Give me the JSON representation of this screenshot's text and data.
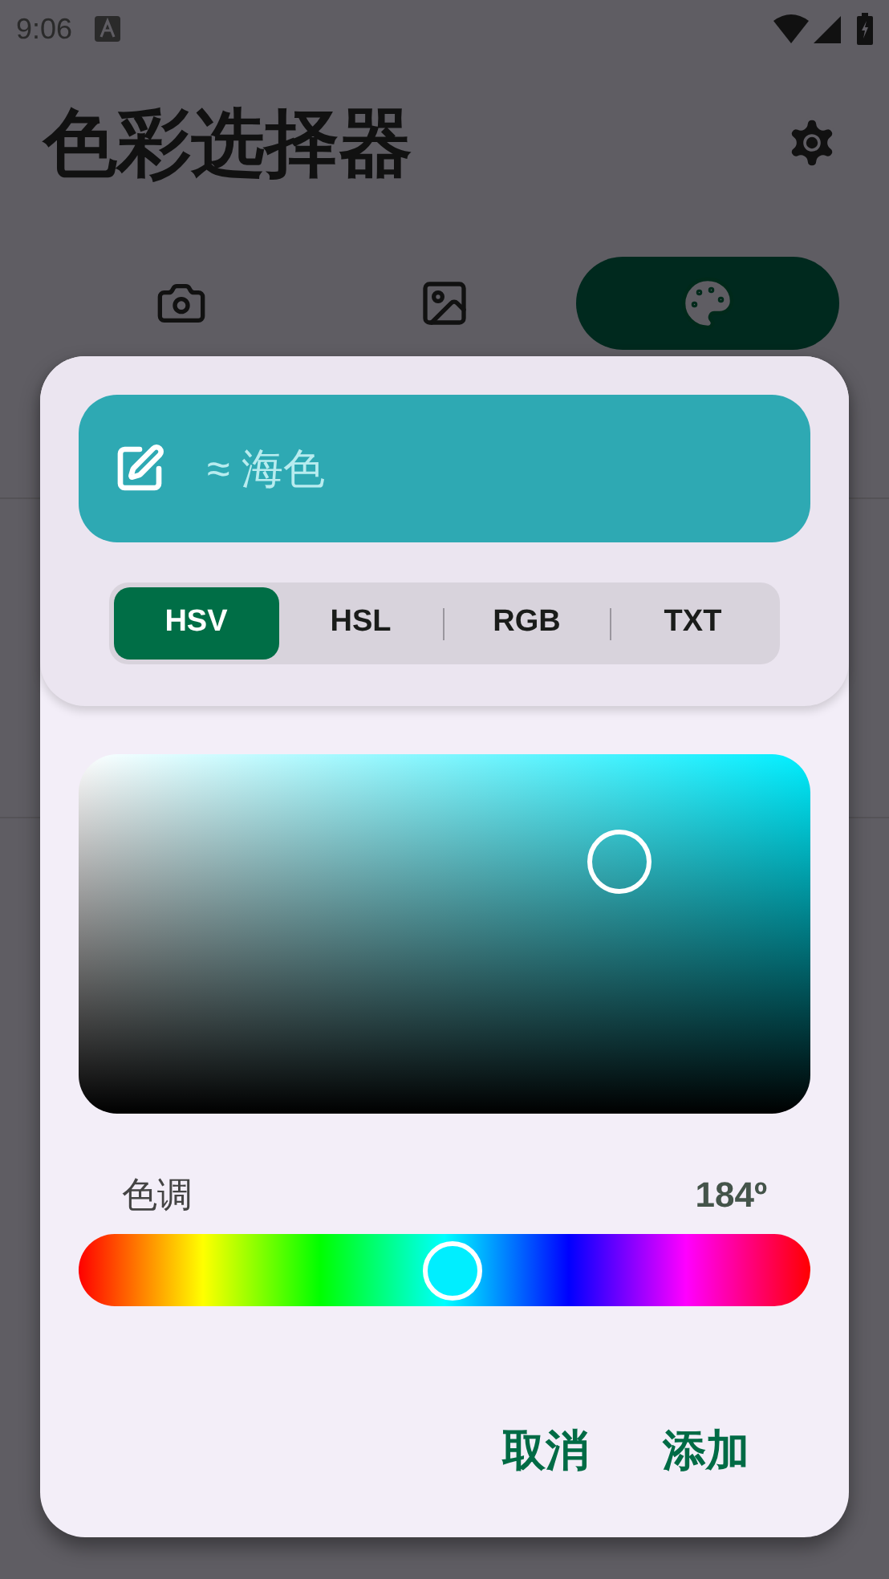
{
  "status_bar": {
    "time": "9:06"
  },
  "app_bar": {
    "title": "色彩选择器"
  },
  "tabs": [
    {
      "kind": "camera",
      "selected": false
    },
    {
      "kind": "image",
      "selected": false
    },
    {
      "kind": "palette",
      "selected": true
    }
  ],
  "dialog": {
    "color_name": {
      "value": "≈ 海色",
      "color": "#2ea9b3"
    },
    "modes": [
      {
        "label": "HSV",
        "selected": true
      },
      {
        "label": "HSL",
        "selected": false
      },
      {
        "label": "RGB",
        "selected": false
      },
      {
        "label": "TXT",
        "selected": false
      }
    ],
    "picker": {
      "saturation": {
        "level": 0.74
      },
      "brightness": {
        "level": 0.7
      }
    },
    "hue": {
      "label": "色调",
      "reading": "184º",
      "level": 0.511
    },
    "buttons": [
      "取消",
      "添加"
    ]
  }
}
